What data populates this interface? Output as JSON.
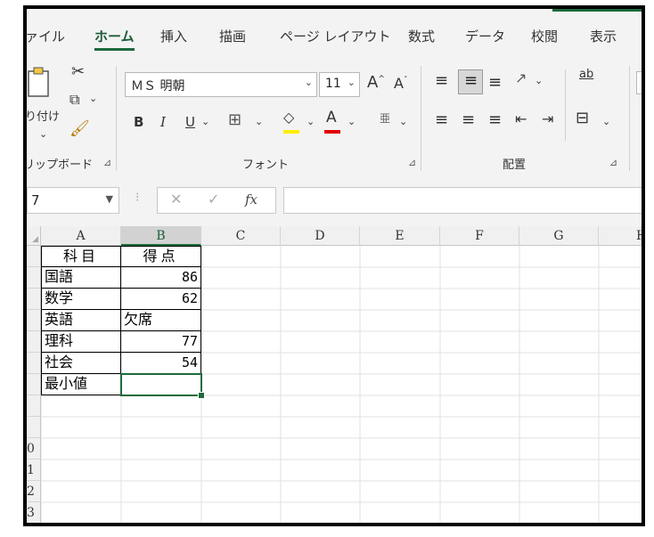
{
  "tabs": [
    "ァイル",
    "ホーム",
    "挿入",
    "描画",
    "ページ レイアウト",
    "数式",
    "データ",
    "校閲",
    "表示"
  ],
  "active_tab": "ホーム",
  "ribbon": {
    "clipboard": {
      "paste_label": "り付け",
      "group_label": "リップボード"
    },
    "font": {
      "family": "ＭＳ 明朝",
      "size": "11",
      "grow": "A",
      "shrink": "A",
      "bold": "B",
      "italic": "I",
      "underline": "U",
      "font_color": "A",
      "group_label": "フォント"
    },
    "alignment": {
      "wrap_text": "ab",
      "group_label": "配置"
    }
  },
  "formula_bar": {
    "name_box": "7",
    "fx": "fx",
    "value": ""
  },
  "colors": {
    "accent": "#1e6b3c",
    "fill_yellow": "#ffee00",
    "font_red": "#e00000"
  },
  "columns": [
    "A",
    "B",
    "C",
    "D",
    "E",
    "F",
    "G",
    "H"
  ],
  "row_numbers": [
    "",
    "",
    "",
    "",
    "",
    "",
    "",
    "",
    "",
    "0",
    "1",
    "2",
    "3"
  ],
  "table": {
    "header": {
      "subject": "科目",
      "score": "得点"
    },
    "rows": [
      {
        "subject": "国語",
        "score": "86"
      },
      {
        "subject": "数学",
        "score": "62"
      },
      {
        "subject": "英語",
        "score": "欠席"
      },
      {
        "subject": "理科",
        "score": "77"
      },
      {
        "subject": "社会",
        "score": "54"
      },
      {
        "subject": "最小値",
        "score": ""
      }
    ]
  }
}
